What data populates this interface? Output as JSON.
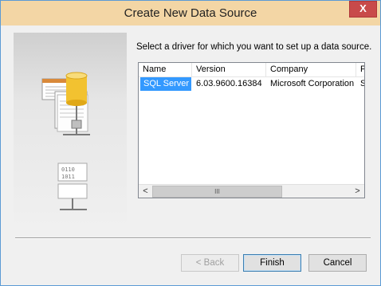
{
  "window": {
    "title": "Create New Data Source",
    "close_label": "X"
  },
  "instruction": "Select a driver for which you want to set up a data source.",
  "driver_list": {
    "columns": [
      "Name",
      "Version",
      "Company",
      "F"
    ],
    "rows": [
      {
        "name": "SQL Server",
        "version": "6.03.9600.16384",
        "company": "Microsoft Corporation",
        "extra": "S",
        "selected": true
      }
    ],
    "scroll": {
      "left_arrow": "<",
      "right_arrow": ">",
      "thumb_grip": "III"
    }
  },
  "buttons": {
    "back": "< Back",
    "finish": "Finish",
    "cancel": "Cancel"
  },
  "icons": [
    "database-driver-icon",
    "close-icon"
  ],
  "colors": {
    "title_bar": "#f3d6a5",
    "selection": "#3399ff",
    "close_button": "#c84a4a"
  }
}
